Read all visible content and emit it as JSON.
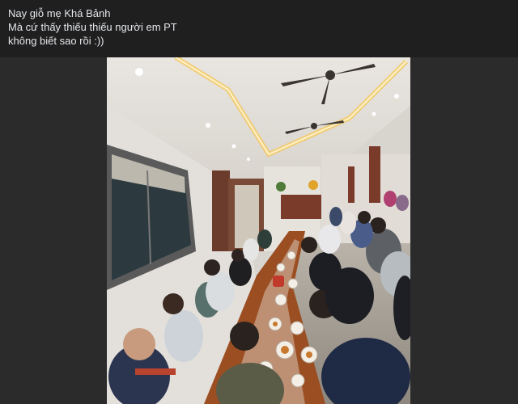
{
  "post": {
    "lines": [
      "Nay giỗ mẹ Khá Bảnh",
      "Mà cứ thấy thiếu thiếu người em PT",
      "không biết sao rồi :))"
    ]
  },
  "media": {
    "photo_icon": "photo-image",
    "colors": {
      "background": "#1f1f1f",
      "frame": "#2b2b2b",
      "text": "#e4e6eb"
    }
  }
}
